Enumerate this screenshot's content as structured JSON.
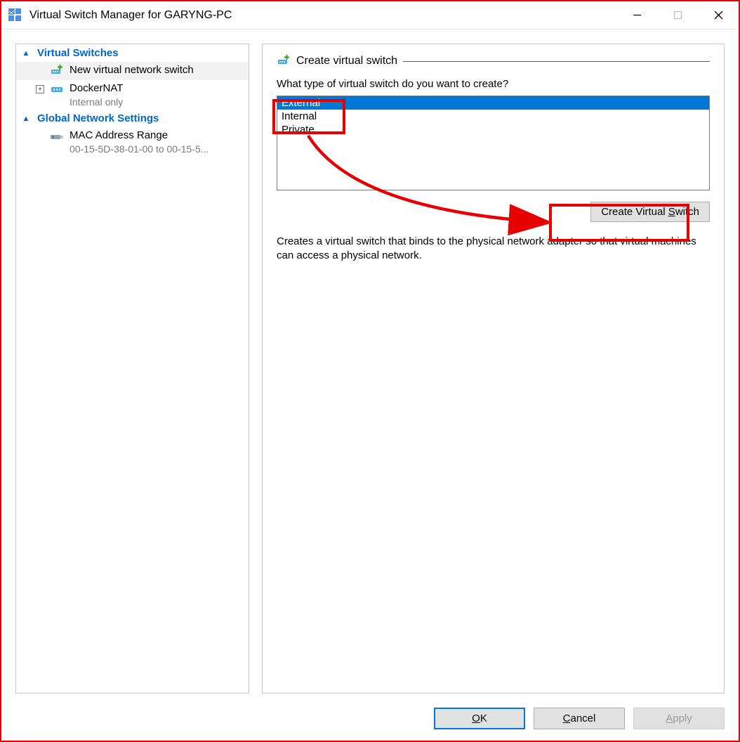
{
  "window": {
    "title": "Virtual Switch Manager for GARYNG-PC"
  },
  "sidebar": {
    "sections": [
      {
        "title": "Virtual Switches",
        "items": [
          {
            "label": "New virtual network switch",
            "type": "new",
            "selected": true
          },
          {
            "label": "DockerNAT",
            "sublabel": "Internal only",
            "type": "switch",
            "expandable": true
          }
        ]
      },
      {
        "title": "Global Network Settings",
        "items": [
          {
            "label": "MAC Address Range",
            "sublabel": "00-15-5D-38-01-00 to 00-15-5...",
            "type": "nic"
          }
        ]
      }
    ]
  },
  "panel": {
    "heading": "Create virtual switch",
    "prompt": "What type of virtual switch do you want to create?",
    "options": [
      "External",
      "Internal",
      "Private"
    ],
    "selected_option": "External",
    "create_button": "Create Virtual Switch",
    "create_button_mnemonic": "S",
    "description": "Creates a virtual switch that binds to the physical network adapter so that virtual machines can access a physical network."
  },
  "footer": {
    "ok": "OK",
    "ok_mnemonic": "O",
    "cancel": "Cancel",
    "cancel_mnemonic": "C",
    "apply": "Apply",
    "apply_mnemonic": "A"
  }
}
